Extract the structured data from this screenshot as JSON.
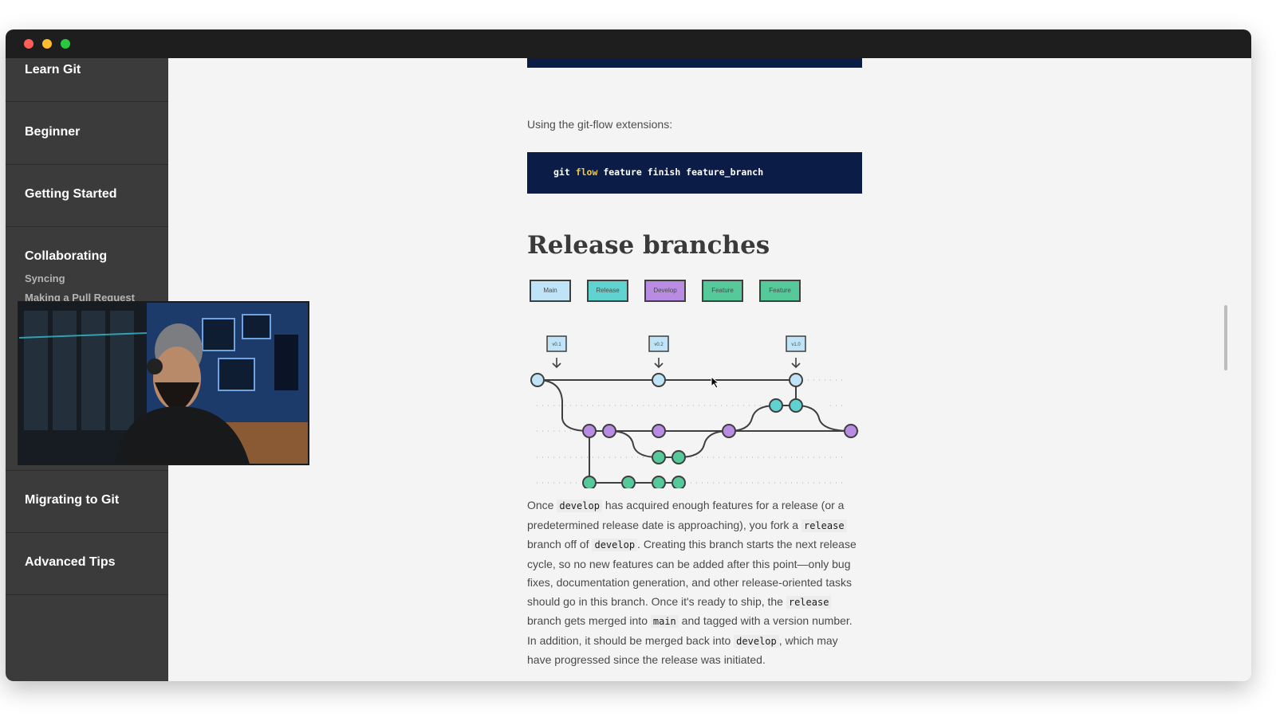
{
  "sidebar": {
    "items": [
      {
        "label": "Learn Git"
      },
      {
        "label": "Beginner"
      },
      {
        "label": "Getting Started"
      },
      {
        "label": "Collaborating",
        "subitems": [
          "Syncing",
          "Making a Pull Request"
        ]
      },
      {
        "label": "Migrating to Git"
      },
      {
        "label": "Advanced Tips"
      }
    ]
  },
  "main": {
    "intro_text": "Using the git-flow extensions:",
    "code": {
      "part1": "git ",
      "keyword": "flow",
      "part2": " feature finish feature_branch"
    },
    "heading": "Release branches",
    "legend": [
      "Main",
      "Release",
      "Develop",
      "Feature",
      "Feature"
    ],
    "diagram_tags": [
      "v0.1",
      "v0.2",
      "v1.0"
    ],
    "paragraph": {
      "p1": "Once ",
      "c1": "develop",
      "p2": " has acquired enough features for a release (or a predetermined release date is approaching), you fork a ",
      "c2": "release",
      "p3": " branch off of ",
      "c3": "develop",
      "p4": ". Creating this branch starts the next release cycle, so no new features can be added after this point—only bug fixes, documentation generation, and other release-oriented tasks should go in this branch. Once it's ready to ship, the ",
      "c4": "release",
      "p5": " branch gets merged into ",
      "c5": "main",
      "p6": " and tagged with a version number. In addition, it should be merged back into ",
      "c6": "develop",
      "p7": ", which may have progressed since the release was initiated."
    }
  },
  "colors": {
    "main": "#bfe3f7",
    "release": "#5fd3cf",
    "develop": "#b98be3",
    "feature": "#56c99a",
    "code_bg": "#0b1d46",
    "sidebar_bg": "#3b3b3b"
  }
}
